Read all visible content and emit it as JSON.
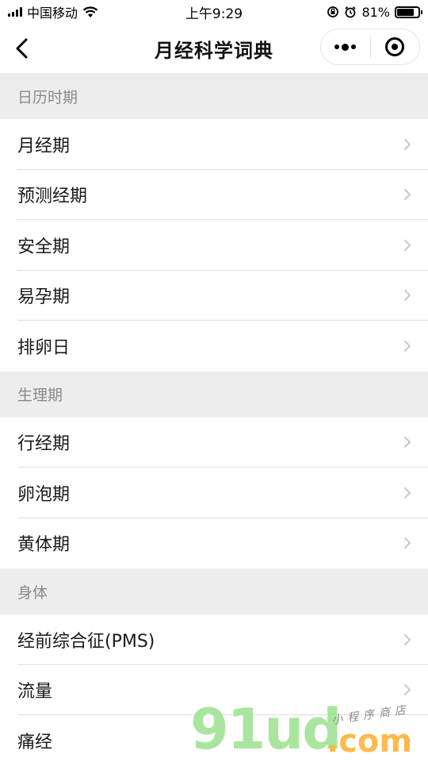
{
  "status_bar": {
    "carrier": "中国移动",
    "time": "上午9:29",
    "battery_percent": "81%",
    "battery_level": 0.81
  },
  "nav": {
    "title": "月经科学词典"
  },
  "sections": [
    {
      "header": "日历时期",
      "items": [
        "月经期",
        "预测经期",
        "安全期",
        "易孕期",
        "排卵日"
      ]
    },
    {
      "header": "生理期",
      "items": [
        "行经期",
        "卵泡期",
        "黄体期"
      ]
    },
    {
      "header": "身体",
      "items": [
        "经前综合征(PMS)",
        "流量",
        "痛经"
      ]
    }
  ],
  "watermark": {
    "logo": "91ud",
    "suffix": ".com",
    "tagline": "小程序商店"
  },
  "colors": {
    "section_bg": "#ededed",
    "section_text": "#8a8a8a",
    "divider": "#dedede",
    "chevron": "#c7c7cc"
  }
}
